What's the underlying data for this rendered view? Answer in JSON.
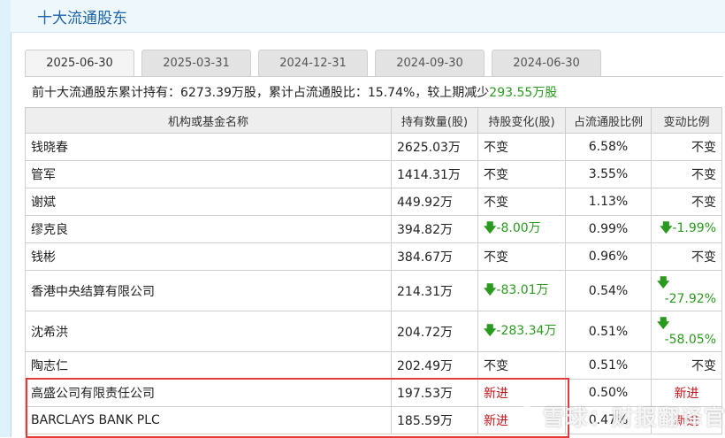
{
  "title": "十大流通股东",
  "tabs": [
    "2025-06-30",
    "2025-03-31",
    "2024-12-31",
    "2024-09-30",
    "2024-06-30"
  ],
  "summary": {
    "prefix": "前十大流通股东累计持有：6273.39万股，累计占流通股比：15.74%，较上期减少",
    "change": "293.55万股"
  },
  "columns": [
    "机构或基金名称",
    "持有数量(股)",
    "持股变化(股)",
    "占流通股比例",
    "变动比例"
  ],
  "rows": [
    {
      "name": "钱晓春",
      "qty": "2625.03万",
      "change": "不变",
      "ratio": "6.58%",
      "var": "不变"
    },
    {
      "name": "管军",
      "qty": "1414.31万",
      "change": "不变",
      "ratio": "3.55%",
      "var": "不变"
    },
    {
      "name": "谢斌",
      "qty": "449.92万",
      "change": "不变",
      "ratio": "1.13%",
      "var": "不变"
    },
    {
      "name": "缪克良",
      "qty": "394.82万",
      "change": "-8.00万",
      "ratio": "0.99%",
      "var": "-1.99%"
    },
    {
      "name": "钱彬",
      "qty": "384.67万",
      "change": "不变",
      "ratio": "0.96%",
      "var": "不变"
    },
    {
      "name": "香港中央结算有限公司",
      "qty": "214.31万",
      "change": "-83.01万",
      "ratio": "0.54%",
      "var": "-27.92%"
    },
    {
      "name": "沈希洪",
      "qty": "204.72万",
      "change": "-283.34万",
      "ratio": "0.51%",
      "var": "-58.05%"
    },
    {
      "name": "陶志仁",
      "qty": "202.49万",
      "change": "不变",
      "ratio": "0.51%",
      "var": "不变"
    },
    {
      "name": "高盛公司有限责任公司",
      "qty": "197.53万",
      "change": "新进",
      "ratio": "0.50%",
      "var": "新进"
    },
    {
      "name": "BARCLAYS BANK PLC",
      "qty": "185.59万",
      "change": "新进",
      "ratio": "0.47%",
      "var": "新进"
    }
  ],
  "watermark": "雪球：财报翻译官",
  "colors": {
    "accent": "#1d64a8",
    "down": "#2a9a1e",
    "new": "#c0171b",
    "highlight": "#e23b3b"
  }
}
